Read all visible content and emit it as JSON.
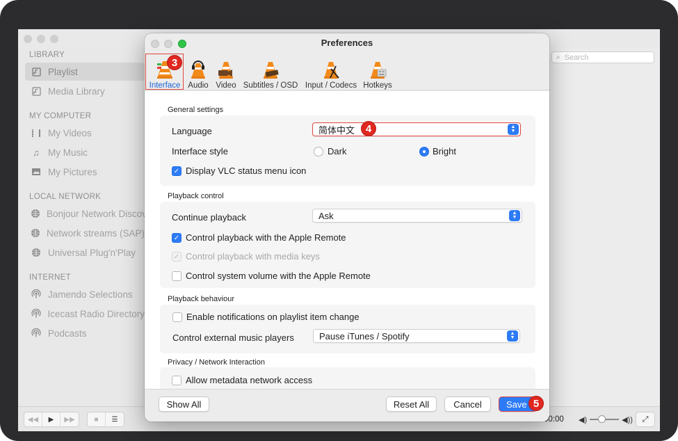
{
  "sidebar": {
    "sections": [
      {
        "header": "LIBRARY",
        "items": [
          {
            "label": "Playlist",
            "icon": "playlist-icon"
          },
          {
            "label": "Media Library",
            "icon": "media-library-icon"
          }
        ]
      },
      {
        "header": "MY COMPUTER",
        "items": [
          {
            "label": "My Videos",
            "icon": "film-icon"
          },
          {
            "label": "My Music",
            "icon": "music-note-icon"
          },
          {
            "label": "My Pictures",
            "icon": "picture-icon"
          }
        ]
      },
      {
        "header": "LOCAL NETWORK",
        "items": [
          {
            "label": "Bonjour Network Discovery",
            "icon": "network-globe-icon"
          },
          {
            "label": "Network streams (SAP)",
            "icon": "network-globe-icon"
          },
          {
            "label": "Universal Plug'n'Play",
            "icon": "network-globe-icon"
          }
        ]
      },
      {
        "header": "INTERNET",
        "items": [
          {
            "label": "Jamendo Selections",
            "icon": "broadcast-icon"
          },
          {
            "label": "Icecast Radio Directory",
            "icon": "broadcast-icon"
          },
          {
            "label": "Podcasts",
            "icon": "broadcast-icon"
          }
        ]
      }
    ]
  },
  "search": {
    "placeholder": "Search"
  },
  "player": {
    "time": "00:00"
  },
  "prefs": {
    "title": "Preferences",
    "tabs": [
      {
        "label": "Interface"
      },
      {
        "label": "Audio"
      },
      {
        "label": "Video"
      },
      {
        "label": "Subtitles / OSD"
      },
      {
        "label": "Input / Codecs"
      },
      {
        "label": "Hotkeys"
      }
    ],
    "general": {
      "title": "General settings",
      "language_label": "Language",
      "language_value": "简体中文",
      "style_label": "Interface style",
      "style_dark": "Dark",
      "style_bright": "Bright",
      "style_selected": "Bright",
      "status_icon_label": "Display VLC status menu icon",
      "status_icon_checked": true
    },
    "playback_control": {
      "title": "Playback control",
      "continue_label": "Continue playback",
      "continue_value": "Ask",
      "apple_remote_label": "Control playback with the Apple Remote",
      "apple_remote_checked": true,
      "media_keys_label": "Control playback with media keys",
      "media_keys_checked": true,
      "media_keys_disabled": true,
      "system_volume_label": "Control system volume with the Apple Remote",
      "system_volume_checked": false
    },
    "playback_behaviour": {
      "title": "Playback behaviour",
      "notifications_label": "Enable notifications on playlist item change",
      "notifications_checked": false,
      "external_label": "Control external music players",
      "external_value": "Pause iTunes / Spotify"
    },
    "privacy": {
      "title": "Privacy / Network Interaction",
      "metadata_label": "Allow metadata network access",
      "metadata_checked": false
    },
    "footer": {
      "show_all": "Show All",
      "reset_all": "Reset All",
      "cancel": "Cancel",
      "save": "Save"
    }
  },
  "annotations": {
    "step3": "3",
    "step4": "4",
    "step5": "5"
  },
  "colors": {
    "accent": "#2d7bf6",
    "highlight": "#e0463e",
    "badge": "#e02720",
    "cone_orange": "#f28a1b"
  }
}
